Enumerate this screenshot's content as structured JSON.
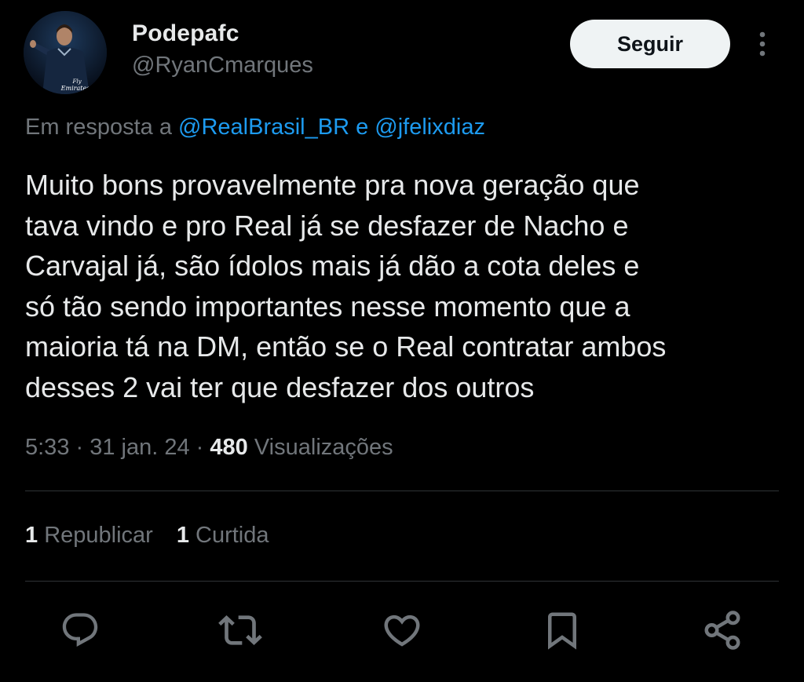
{
  "user": {
    "display_name": "Podepafc",
    "handle": "@RyanCmarques",
    "avatar_text": "Fly Emirates"
  },
  "header": {
    "follow_label": "Seguir"
  },
  "reply": {
    "prefix": "Em resposta a ",
    "mention_1": "@RealBrasil_BR",
    "connector": " e ",
    "mention_2": "@jfelixdiaz"
  },
  "tweet": {
    "text": "Muito bons provavelmente pra nova geração que\ntava vindo e pro Real já se desfazer de Nacho e\nCarvajal já, são ídolos mais já dão a cota deles e\nsó tão sendo importantes nesse momento que a\nmaioria tá na DM, então se o Real contratar ambos\ndesses 2 vai ter que desfazer dos outros"
  },
  "meta": {
    "time": "5:33",
    "separator": " · ",
    "date": "31 jan. 24",
    "views_count": "480",
    "views_label": " Visualizações"
  },
  "stats": {
    "reposts_count": "1",
    "reposts_label": " Republicar",
    "likes_count": "1",
    "likes_label": " Curtida"
  },
  "actions": [
    {
      "icon": "reply-icon"
    },
    {
      "icon": "repost-icon"
    },
    {
      "icon": "like-icon"
    },
    {
      "icon": "bookmark-icon"
    },
    {
      "icon": "share-icon"
    }
  ],
  "colors": {
    "background": "#000000",
    "primary_text": "#e7e9ea",
    "secondary_text": "#71767b",
    "mention": "#1d9bf0",
    "divider": "#2f3336",
    "follow_bg": "#eff3f4"
  }
}
